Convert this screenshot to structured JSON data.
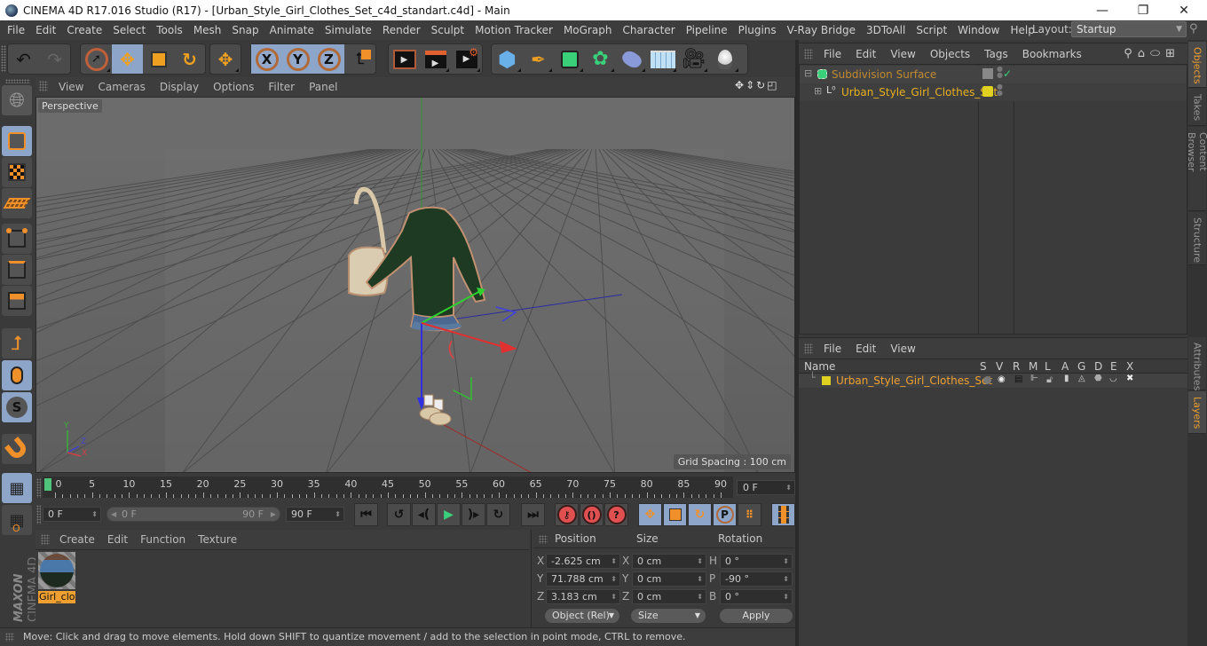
{
  "window": {
    "title": "CINEMA 4D R17.016 Studio (R17) - [Urban_Style_Girl_Clothes_Set_c4d_standart.c4d] - Main",
    "controls": {
      "minimize": "—",
      "maximize": "❐",
      "close": "✕"
    }
  },
  "menubar": {
    "items": [
      "File",
      "Edit",
      "Create",
      "Select",
      "Tools",
      "Mesh",
      "Snap",
      "Animate",
      "Simulate",
      "Render",
      "Sculpt",
      "Motion Tracker",
      "MoGraph",
      "Character",
      "Pipeline",
      "Plugins",
      "V-Ray Bridge",
      "3DToAll",
      "Script",
      "Window",
      "Help"
    ],
    "layout_label": "Layout:",
    "layout_value": "Startup"
  },
  "toolbar": {
    "undo": "undo-icon",
    "redo": "redo-icon",
    "axis": [
      "X",
      "Y",
      "Z"
    ]
  },
  "viewport": {
    "menu": [
      "View",
      "Cameras",
      "Display",
      "Options",
      "Filter",
      "Panel"
    ],
    "camera_label": "Perspective",
    "grid_spacing": "Grid Spacing : 100 cm",
    "axis_labels": {
      "x": "X",
      "y": "Y",
      "z": "Z"
    }
  },
  "timeline": {
    "ticks": [
      0,
      5,
      10,
      15,
      20,
      25,
      30,
      35,
      40,
      45,
      50,
      55,
      60,
      65,
      70,
      75,
      80,
      85,
      90
    ],
    "current_frame": "0 F",
    "start_field": "0 F",
    "range_start": "0 F",
    "range_end": "90 F",
    "end_field": "90 F"
  },
  "material_manager": {
    "menu": [
      "Create",
      "Edit",
      "Function",
      "Texture"
    ],
    "materials": [
      {
        "name": "Girl_clot"
      }
    ]
  },
  "coordinates": {
    "headers": {
      "position": "Position",
      "size": "Size",
      "rotation": "Rotation"
    },
    "rows": [
      {
        "axis": "X",
        "position": "-2.625 cm",
        "size_axis": "X",
        "size": "0 cm",
        "rot_axis": "H",
        "rotation": "0 °"
      },
      {
        "axis": "Y",
        "position": "71.788 cm",
        "size_axis": "Y",
        "size": "0 cm",
        "rot_axis": "P",
        "rotation": "-90 °"
      },
      {
        "axis": "Z",
        "position": "3.183 cm",
        "size_axis": "Z",
        "size": "0 cm",
        "rot_axis": "B",
        "rotation": "0 °"
      }
    ],
    "mode": "Object (Rel)",
    "size_mode": "Size",
    "apply": "Apply"
  },
  "status": {
    "text": "Move: Click and drag to move elements. Hold down SHIFT to quantize movement / add to the selection in point mode, CTRL to remove."
  },
  "object_manager": {
    "menu": [
      "File",
      "Edit",
      "View",
      "Objects",
      "Tags",
      "Bookmarks"
    ],
    "objects": [
      {
        "name": "Subdivision Surface",
        "color": "#c08a30"
      },
      {
        "name": "Urban_Style_Girl_Clothes_Set",
        "color": "#e8b020"
      }
    ]
  },
  "right_tabs": {
    "top": [
      "Objects",
      "Takes",
      "Content Browser",
      "Structure"
    ],
    "bottom": [
      "Attributes",
      "Layers"
    ]
  },
  "layer_manager": {
    "menu": [
      "File",
      "Edit",
      "View"
    ],
    "columns": [
      "Name",
      "S",
      "V",
      "R",
      "M",
      "L",
      "A",
      "G",
      "D",
      "E",
      "X"
    ],
    "layers": [
      {
        "name": "Urban_Style_Girl_Clothes_Set",
        "color": "#e0d020"
      }
    ]
  },
  "branding": {
    "maxon": "MAXON",
    "product": "CINEMA 4D"
  },
  "colors": {
    "accent": "#f0a030",
    "selected_button": "#8da5c9",
    "playhead": "#4fc37a"
  }
}
